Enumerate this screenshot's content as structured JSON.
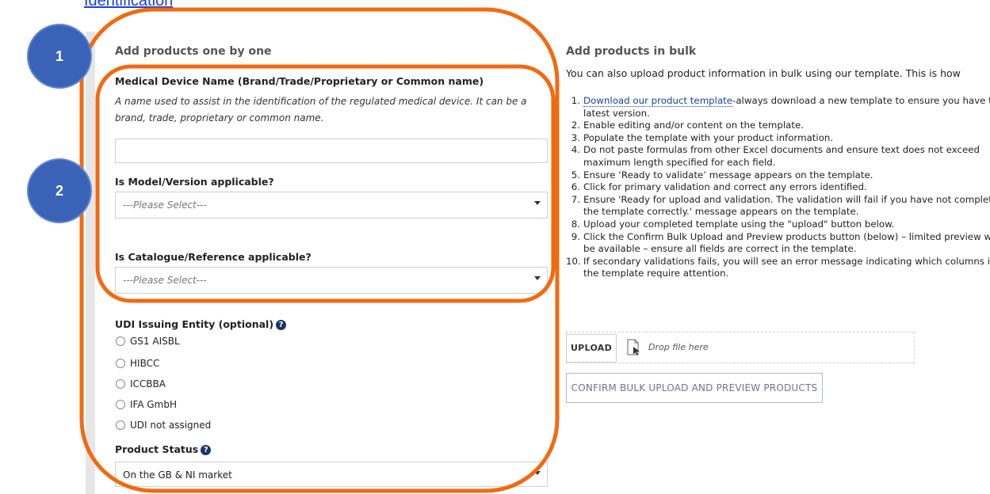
{
  "top_link": "Identification",
  "left": {
    "title": "Add products one by one",
    "device_name_label": "Medical Device Name (Brand/Trade/Proprietary or Common name)",
    "device_name_help_line1": "A name used to assist in the identification of the regulated medical device. It can be a",
    "device_name_help_line2": "brand, trade, proprietary or common name.",
    "device_name_value": "",
    "model_label": "Is Model/Version applicable?",
    "model_placeholder": "---Please Select---",
    "catalogue_label": "Is Catalogue/Reference applicable?",
    "catalogue_placeholder": "---Please Select---",
    "udi_label": "UDI Issuing Entity (optional)",
    "udi_options": [
      "GS1 AISBL",
      "HIBCC",
      "ICCBBA",
      "IFA GmbH",
      "UDI not assigned"
    ],
    "status_label": "Product Status",
    "status_value": "On the GB & NI market"
  },
  "right": {
    "title": "Add products in bulk",
    "intro": "You can also upload product information in bulk using our template. This is how",
    "steps": [
      {
        "num": "1.",
        "link": "Download our product template",
        "text": "-always download a new template to ensure you have the latest version."
      },
      {
        "num": "2.",
        "text": "Enable editing and/or content on the template."
      },
      {
        "num": "3.",
        "text": "Populate the template with your product information."
      },
      {
        "num": "4.",
        "text": "Do not paste formulas from other Excel documents and ensure text does not exceed maximum length specified for each field."
      },
      {
        "num": "5.",
        "text": "Ensure ‘Ready to validate’ message appears on the template."
      },
      {
        "num": "6.",
        "text": "Click for primary validation and correct any errors identified."
      },
      {
        "num": "7.",
        "text": "Ensure 'Ready for upload and validation. The validation will fail if you have not completed the template correctly.' message appears on the template."
      },
      {
        "num": "8.",
        "text": "Upload your completed template using the \"upload\" button below."
      },
      {
        "num": "9.",
        "text": "Click the Confirm Bulk Upload and Preview products button (below) – limited preview will be available – ensure all fields are correct in the template."
      },
      {
        "num": "10.",
        "text": "If secondary validations fails, you will see an error message indicating which columns in the template require attention."
      }
    ],
    "upload_label": "UPLOAD",
    "drop_text": "Drop file here",
    "confirm_label": "CONFIRM BULK UPLOAD AND PREVIEW PRODUCTS"
  },
  "annotations": {
    "badge_1": "1",
    "badge_2": "2",
    "color": "#f26a10"
  },
  "icons": {
    "help": "question-circle-icon",
    "file": "file-drop-icon",
    "dropdown": "chevron-down-icon"
  }
}
